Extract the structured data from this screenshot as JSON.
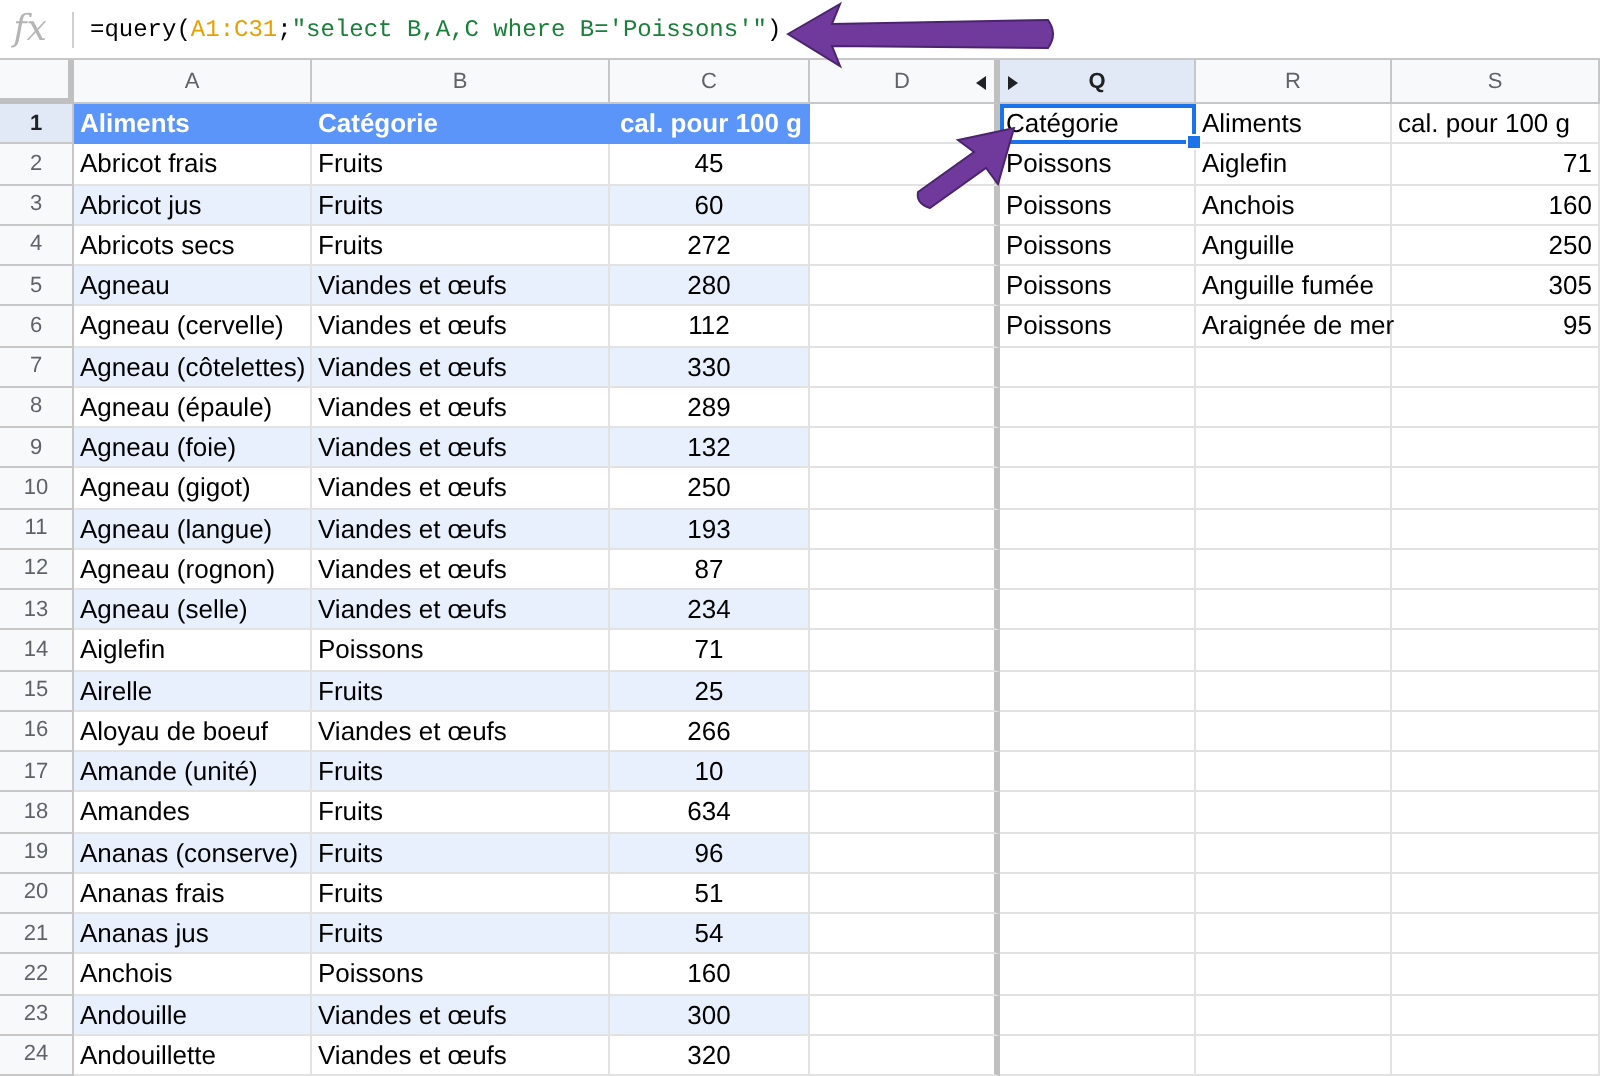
{
  "formula_bar": {
    "fx_label": "fx",
    "formula": [
      {
        "text": "=query(",
        "color": "#000000"
      },
      {
        "text": "A1:C31",
        "color": "#e8a000"
      },
      {
        "text": ";",
        "color": "#000000"
      },
      {
        "text": "\"select B,A,C where B='Poissons'\"",
        "color": "#188038"
      },
      {
        "text": ")",
        "color": "#000000"
      }
    ]
  },
  "columns": [
    {
      "label": "A",
      "selected": false
    },
    {
      "label": "B",
      "selected": false
    },
    {
      "label": "C",
      "selected": false
    },
    {
      "label": "D",
      "selected": false
    },
    {
      "label": "Q",
      "selected": true
    },
    {
      "label": "R",
      "selected": false
    },
    {
      "label": "S",
      "selected": false
    }
  ],
  "row_numbers": [
    {
      "label": "1",
      "selected": true
    },
    {
      "label": "2",
      "selected": false
    },
    {
      "label": "3",
      "selected": false
    },
    {
      "label": "4",
      "selected": false
    },
    {
      "label": "5",
      "selected": false
    },
    {
      "label": "6",
      "selected": false
    },
    {
      "label": "7",
      "selected": false
    },
    {
      "label": "8",
      "selected": false
    },
    {
      "label": "9",
      "selected": false
    },
    {
      "label": "10",
      "selected": false
    },
    {
      "label": "11",
      "selected": false
    },
    {
      "label": "12",
      "selected": false
    },
    {
      "label": "13",
      "selected": false
    },
    {
      "label": "14",
      "selected": false
    },
    {
      "label": "15",
      "selected": false
    },
    {
      "label": "16",
      "selected": false
    },
    {
      "label": "17",
      "selected": false
    },
    {
      "label": "18",
      "selected": false
    },
    {
      "label": "19",
      "selected": false
    },
    {
      "label": "20",
      "selected": false
    },
    {
      "label": "21",
      "selected": false
    },
    {
      "label": "22",
      "selected": false
    },
    {
      "label": "23",
      "selected": false
    },
    {
      "label": "24",
      "selected": false
    }
  ],
  "source_table": {
    "header": [
      "Aliments",
      "Catégorie",
      "cal. pour 100 g"
    ],
    "rows": [
      [
        "Abricot frais",
        "Fruits",
        "45"
      ],
      [
        "Abricot jus",
        "Fruits",
        "60"
      ],
      [
        "Abricots secs",
        "Fruits",
        "272"
      ],
      [
        "Agneau",
        "Viandes et œufs",
        "280"
      ],
      [
        "Agneau (cervelle)",
        "Viandes et œufs",
        "112"
      ],
      [
        "Agneau (côtelettes)",
        "Viandes et œufs",
        "330"
      ],
      [
        "Agneau (épaule)",
        "Viandes et œufs",
        "289"
      ],
      [
        "Agneau (foie)",
        "Viandes et œufs",
        "132"
      ],
      [
        "Agneau (gigot)",
        "Viandes et œufs",
        "250"
      ],
      [
        "Agneau (langue)",
        "Viandes et œufs",
        "193"
      ],
      [
        "Agneau (rognon)",
        "Viandes et œufs",
        "87"
      ],
      [
        "Agneau (selle)",
        "Viandes et œufs",
        "234"
      ],
      [
        "Aiglefin",
        "Poissons",
        "71"
      ],
      [
        "Airelle",
        "Fruits",
        "25"
      ],
      [
        "Aloyau de boeuf",
        "Viandes et œufs",
        "266"
      ],
      [
        "Amande (unité)",
        "Fruits",
        "10"
      ],
      [
        "Amandes",
        "Fruits",
        "634"
      ],
      [
        "Ananas (conserve)",
        "Fruits",
        "96"
      ],
      [
        "Ananas frais",
        "Fruits",
        "51"
      ],
      [
        "Ananas jus",
        "Fruits",
        "54"
      ],
      [
        "Anchois",
        "Poissons",
        "160"
      ],
      [
        "Andouille",
        "Viandes et œufs",
        "300"
      ],
      [
        "Andouillette",
        "Viandes et œufs",
        "320"
      ]
    ]
  },
  "query_result": {
    "header": [
      "Catégorie",
      "Aliments",
      "cal. pour 100 g"
    ],
    "rows": [
      [
        "Poissons",
        "Aiglefin",
        "71"
      ],
      [
        "Poissons",
        "Anchois",
        "160"
      ],
      [
        "Poissons",
        "Anguille",
        "250"
      ],
      [
        "Poissons",
        "Anguille fumée",
        "305"
      ],
      [
        "Poissons",
        "Araignée de mer",
        "95"
      ]
    ]
  }
}
